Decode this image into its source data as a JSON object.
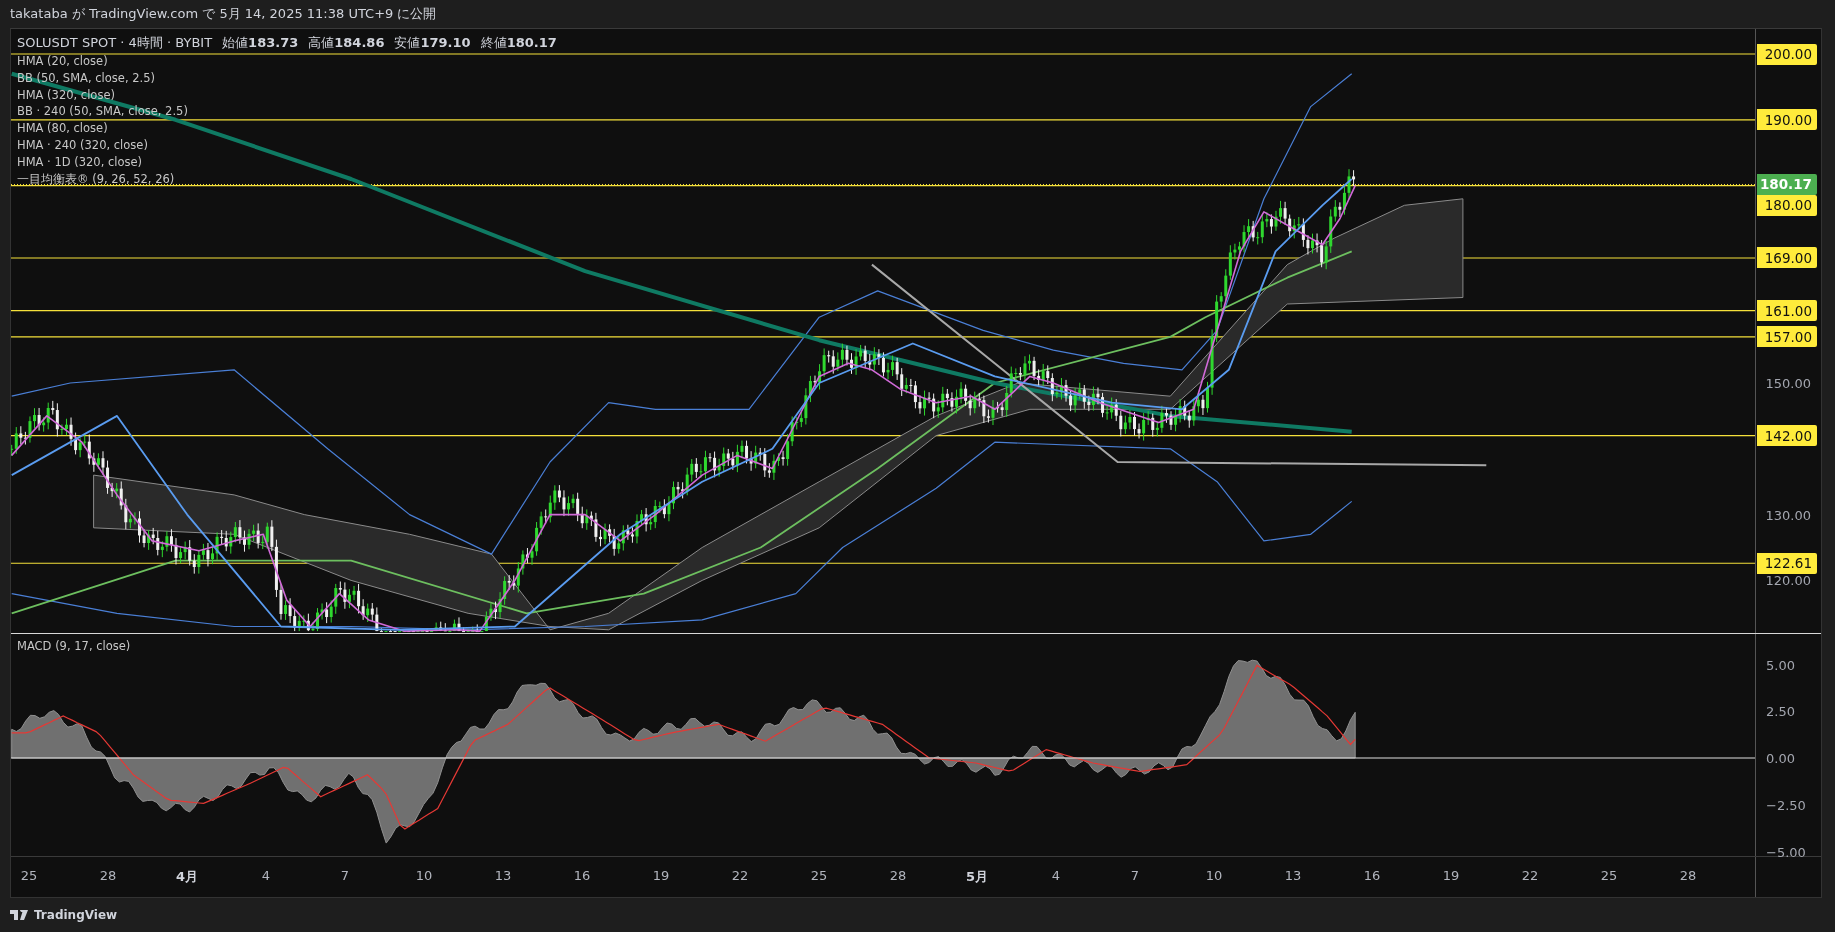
{
  "header": {
    "text": "takataba が TradingView.com で 5月 14, 2025 11:38 UTC+9 に公開"
  },
  "price_pane": {
    "symbol": "SOLUSDT SPOT · 4時間 · BYBIT",
    "ohlc": [
      {
        "label": "始値",
        "value": "183.73"
      },
      {
        "label": "高値",
        "value": "184.86"
      },
      {
        "label": "安値",
        "value": "179.10"
      },
      {
        "label": "終値",
        "value": "180.17"
      }
    ],
    "indicators": [
      "HMA (20, close)",
      "BB (50, SMA, close, 2.5)",
      "HMA (320, close)",
      "BB · 240 (50, SMA, close, 2.5)",
      "HMA (80, close)",
      "HMA · 240 (320, close)",
      "HMA · 1D (320, close)",
      "一目均衡表® (9, 26, 52, 26)"
    ],
    "price_levels": [
      "200.00",
      "190.00",
      "180.00",
      "169.00",
      "161.00",
      "157.00",
      "142.00",
      "122.61"
    ],
    "current_price": "180.17",
    "axis_ticks": [
      "150.00",
      "130.00",
      "120.00"
    ]
  },
  "macd_pane": {
    "title": "MACD (9, 17, close)",
    "axis_ticks": [
      "5.00",
      "2.50",
      "0.00",
      "−2.50",
      "−5.00"
    ]
  },
  "time_axis": [
    {
      "label": "25",
      "kind": "day"
    },
    {
      "label": "28",
      "kind": "day"
    },
    {
      "label": "4月",
      "kind": "month"
    },
    {
      "label": "4",
      "kind": "day"
    },
    {
      "label": "7",
      "kind": "day"
    },
    {
      "label": "10",
      "kind": "day"
    },
    {
      "label": "13",
      "kind": "day"
    },
    {
      "label": "16",
      "kind": "day"
    },
    {
      "label": "19",
      "kind": "day"
    },
    {
      "label": "22",
      "kind": "day"
    },
    {
      "label": "25",
      "kind": "day"
    },
    {
      "label": "28",
      "kind": "day"
    },
    {
      "label": "5月",
      "kind": "month"
    },
    {
      "label": "4",
      "kind": "day"
    },
    {
      "label": "7",
      "kind": "day"
    },
    {
      "label": "10",
      "kind": "day"
    },
    {
      "label": "13",
      "kind": "day"
    },
    {
      "label": "16",
      "kind": "day"
    },
    {
      "label": "19",
      "kind": "day"
    },
    {
      "label": "22",
      "kind": "day"
    },
    {
      "label": "25",
      "kind": "day"
    },
    {
      "label": "28",
      "kind": "day"
    }
  ],
  "footer": {
    "brand": "TradingView"
  }
}
